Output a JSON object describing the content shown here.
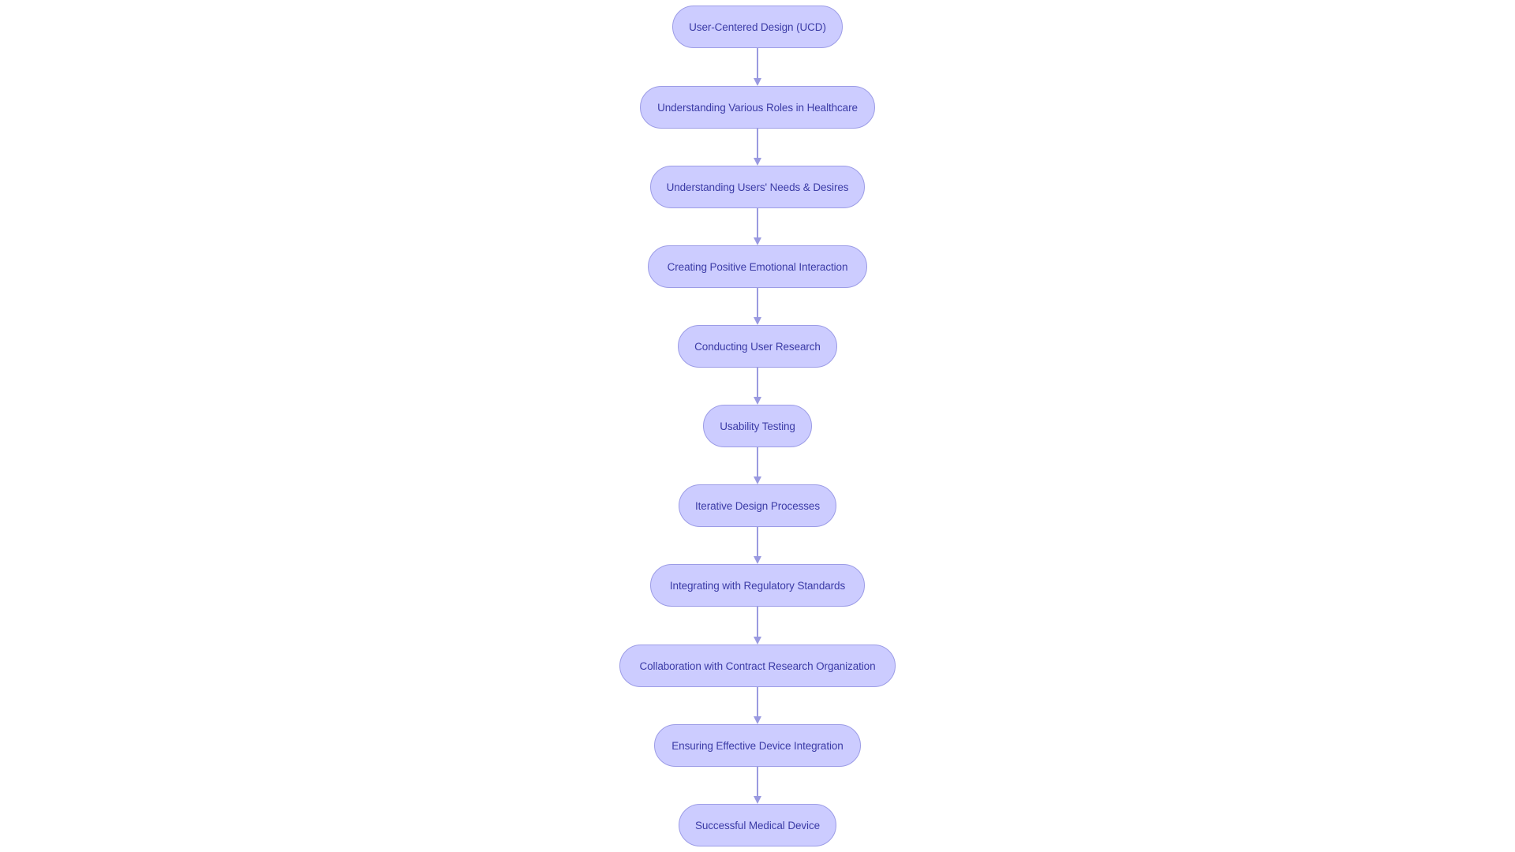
{
  "diagram": {
    "type": "flowchart",
    "direction": "top-to-bottom",
    "colors": {
      "node_fill": "#ccccff",
      "node_border": "#9c9ce6",
      "node_text": "#3b3ba6",
      "edge": "#9a9ae0",
      "background": "#ffffff"
    },
    "nodes": [
      {
        "id": "n1",
        "label": "User-Centered Design (UCD)"
      },
      {
        "id": "n2",
        "label": "Understanding Various Roles in Healthcare"
      },
      {
        "id": "n3",
        "label": "Understanding Users' Needs & Desires"
      },
      {
        "id": "n4",
        "label": "Creating Positive Emotional Interaction"
      },
      {
        "id": "n5",
        "label": "Conducting User Research"
      },
      {
        "id": "n6",
        "label": "Usability Testing"
      },
      {
        "id": "n7",
        "label": "Iterative Design Processes"
      },
      {
        "id": "n8",
        "label": "Integrating with Regulatory Standards"
      },
      {
        "id": "n9",
        "label": "Collaboration with Contract Research Organization"
      },
      {
        "id": "n10",
        "label": "Ensuring Effective Device Integration"
      },
      {
        "id": "n11",
        "label": "Successful Medical Device"
      }
    ],
    "edges": [
      {
        "from": "n1",
        "to": "n2"
      },
      {
        "from": "n2",
        "to": "n3"
      },
      {
        "from": "n3",
        "to": "n4"
      },
      {
        "from": "n4",
        "to": "n5"
      },
      {
        "from": "n5",
        "to": "n6"
      },
      {
        "from": "n6",
        "to": "n7"
      },
      {
        "from": "n7",
        "to": "n8"
      },
      {
        "from": "n8",
        "to": "n9"
      },
      {
        "from": "n9",
        "to": "n10"
      },
      {
        "from": "n10",
        "to": "n11"
      }
    ]
  }
}
